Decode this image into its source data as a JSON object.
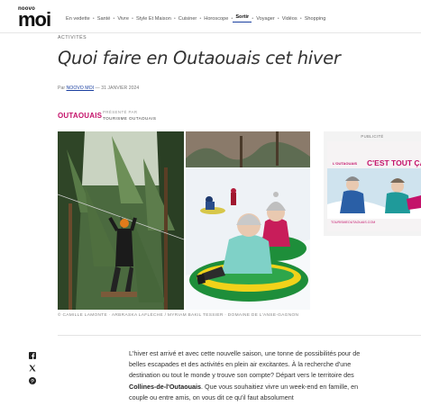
{
  "logo": {
    "sup": "noovo",
    "main": "moi"
  },
  "nav": {
    "items": [
      {
        "label": "En vedette",
        "active": false
      },
      {
        "label": "Santé",
        "active": false
      },
      {
        "label": "Vivre",
        "active": false
      },
      {
        "label": "Style Et Maison",
        "active": false
      },
      {
        "label": "Cuisiner",
        "active": false
      },
      {
        "label": "Horoscope",
        "active": false
      },
      {
        "label": "Sortir",
        "active": true
      },
      {
        "label": "Voyager",
        "active": false
      },
      {
        "label": "Vidéos",
        "active": false
      },
      {
        "label": "Shopping",
        "active": false
      }
    ]
  },
  "article": {
    "kicker": "ACTIVITÉS",
    "title": "Quoi faire en Outaouais cet hiver",
    "byline_prefix": "Par",
    "author": "NOOVO MOI",
    "byline_sep": "—",
    "date": "31 JANVIER 2024",
    "sponsor": {
      "logo_text": "OUTAOUAIS",
      "presented": "PRÉSENTÉ PAR",
      "name": "TOURISME OUTAOUAIS"
    },
    "caption": "© CAMILLE LAMONTE · ARBRASKA LAFLÈCHE / MYRIAM BAKIL TESSIER · DOMAINE DE L'ANSE-GAGNON",
    "body_p1": "L'hiver est arrivé et avec cette nouvelle saison, une tonne de possibilités pour de belles escapades et des activités en plein air excitantes. À la recherche d'une destination ou tout le monde y trouve son compte? Départ vers le territoire des ",
    "body_strong": "Collines-de-l'Outaouais",
    "body_p2": ". Que vous souhaitiez vivre un week-end en famille, en couple ou entre amis, on vous dit ce qu'il faut absolument"
  },
  "ad": {
    "label": "PUBLICITÉ",
    "brand": "L'OUTAOUAIS",
    "headline": "C'EST TOUT ÇA!",
    "footer": "TOURISMEOUTAOUAIS.COM"
  },
  "share": {
    "icons": [
      "facebook-icon",
      "x-icon",
      "pinterest-icon"
    ]
  },
  "colors": {
    "accent": "#1a3fa0",
    "sponsor": "#c4126a"
  }
}
